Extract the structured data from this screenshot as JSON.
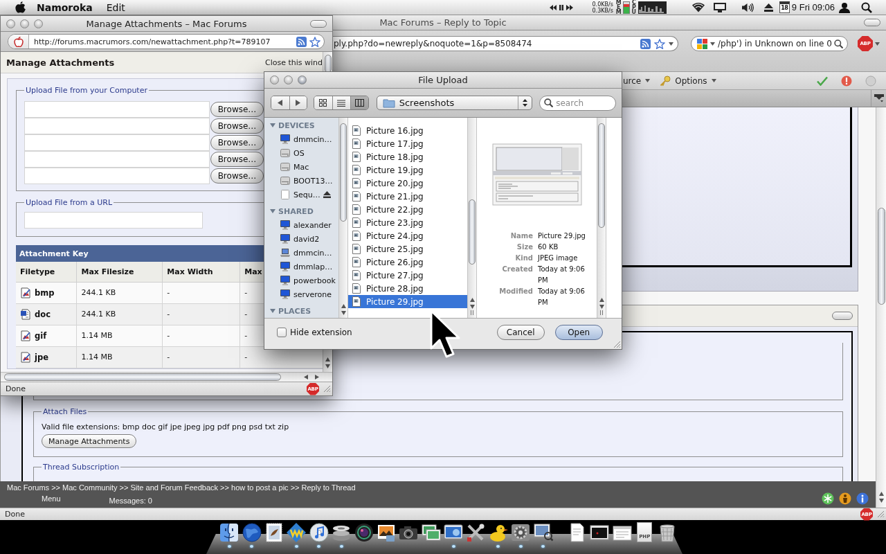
{
  "menu_bar": {
    "app_name": "Namoroka",
    "menus": [
      "Edit"
    ],
    "net_down": "0.0KB/s",
    "net_up": "0.3KB/s",
    "mem_label": "MEM",
    "cpu_label": "CPU",
    "calendar_day": "18",
    "clock": "9 Fri 09:06"
  },
  "browser": {
    "title": "Mac Forums – Reply to Topic",
    "url": "ply.php?do=newreply&noquote=1&p=8508474",
    "search_value": "/php') in Unknown on line 0",
    "addon_badge": "ABP",
    "toolbar_menus": [
      {
        "kind": "plain",
        "label": "urce"
      },
      {
        "kind": "key",
        "label": "Options"
      }
    ],
    "page": {
      "attach_files": {
        "legend": "Attach Files",
        "extensions": "Valid file extensions: bmp doc gif jpe jpeg jpg pdf png psd txt zip",
        "button": "Manage Attachments"
      },
      "thread_subscription": {
        "legend": "Thread Subscription"
      }
    },
    "footer": {
      "breadcrumb": "Mac Forums >> Mac Community >> Site and Forum Feedback >> how to post a pic >> Reply to Thread",
      "menu": "Menu",
      "messages": "Messages: 0"
    },
    "status": "Done",
    "status_badge": "ABP"
  },
  "attachments_window": {
    "title": "Manage Attachments – Mac Forums",
    "url": "http://forums.macrumors.com/newattachment.php?t=789107",
    "heading": "Manage Attachments",
    "close_link": "Close this wind",
    "upload_computer": {
      "legend": "Upload File from your Computer",
      "browse_buttons": [
        "Browse…",
        "Browse…",
        "Browse…",
        "Browse…",
        "Browse…"
      ]
    },
    "upload_url": {
      "legend": "Upload File from a URL"
    },
    "attachment_key": {
      "title": "Attachment Key",
      "columns": [
        "Filetype",
        "Max Filesize",
        "Max Width",
        "Max"
      ],
      "rows": [
        {
          "kind": "image",
          "filetype": "bmp",
          "max_filesize": "244.1 KB",
          "max_width": "-",
          "column_4": "-"
        },
        {
          "kind": "document",
          "filetype": "doc",
          "max_filesize": "244.1 KB",
          "max_width": "-",
          "column_4": "-"
        },
        {
          "kind": "image",
          "filetype": "gif",
          "max_filesize": "1.14 MB",
          "max_width": "-",
          "column_4": "-"
        },
        {
          "kind": "image",
          "filetype": "jpe",
          "max_filesize": "1.14 MB",
          "max_width": "-",
          "column_4": "-"
        }
      ]
    },
    "status": "Done",
    "status_badge": "ABP"
  },
  "file_dialog": {
    "title": "File Upload",
    "view_modes": [
      {
        "kind": "icon",
        "selected": false
      },
      {
        "kind": "list",
        "selected": false
      },
      {
        "kind": "column",
        "selected": true
      }
    ],
    "location": "Screenshots",
    "search_placeholder": "search",
    "sidebar": [
      {
        "heading": "DEVICES",
        "expanded": true,
        "items": [
          {
            "kind": "monitor",
            "label": "dmmcin…",
            "eject": false
          },
          {
            "kind": "disk",
            "label": "OS",
            "eject": false
          },
          {
            "kind": "disk",
            "label": "Mac",
            "eject": false
          },
          {
            "kind": "disk",
            "label": "BOOT13…",
            "eject": false
          },
          {
            "kind": "blank-disk",
            "label": "Sequ…",
            "eject": true
          }
        ]
      },
      {
        "heading": "SHARED",
        "expanded": true,
        "items": [
          {
            "kind": "monitor",
            "label": "alexander",
            "eject": false
          },
          {
            "kind": "monitor",
            "label": "david2",
            "eject": false
          },
          {
            "kind": "laptop",
            "label": "dmmcin…",
            "eject": false
          },
          {
            "kind": "monitor",
            "label": "dmmlap…",
            "eject": false
          },
          {
            "kind": "monitor",
            "label": "powerbook",
            "eject": false
          },
          {
            "kind": "monitor",
            "label": "serverone",
            "eject": false
          }
        ]
      },
      {
        "heading": "PLACES",
        "expanded": true
      }
    ],
    "files": [
      {
        "name": "Picture 16.jpg",
        "selected": false
      },
      {
        "name": "Picture 17.jpg",
        "selected": false
      },
      {
        "name": "Picture 18.jpg",
        "selected": false
      },
      {
        "name": "Picture 19.jpg",
        "selected": false
      },
      {
        "name": "Picture 20.jpg",
        "selected": false
      },
      {
        "name": "Picture 21.jpg",
        "selected": false
      },
      {
        "name": "Picture 22.jpg",
        "selected": false
      },
      {
        "name": "Picture 23.jpg",
        "selected": false
      },
      {
        "name": "Picture 24.jpg",
        "selected": false
      },
      {
        "name": "Picture 25.jpg",
        "selected": false
      },
      {
        "name": "Picture 26.jpg",
        "selected": false
      },
      {
        "name": "Picture 27.jpg",
        "selected": false
      },
      {
        "name": "Picture 28.jpg",
        "selected": false
      },
      {
        "name": "Picture 29.jpg",
        "selected": true
      }
    ],
    "preview": [
      {
        "label": "Name",
        "value": "Picture 29.jpg"
      },
      {
        "label": "Size",
        "value": "60 KB"
      },
      {
        "label": "Kind",
        "value": "JPEG image"
      },
      {
        "label": "Created",
        "value": "Today at 9:06 PM"
      },
      {
        "label": "Modified",
        "value": "Today at 9:06 PM"
      }
    ],
    "hide_extension": {
      "label": "Hide extension",
      "checked": false
    },
    "buttons": [
      {
        "label": "Cancel",
        "default": false
      },
      {
        "label": "Open",
        "default": true
      }
    ]
  },
  "dock": {
    "apps": [
      {
        "kind": "finder",
        "running": true
      },
      {
        "kind": "globe",
        "running": true
      },
      {
        "kind": "stamp",
        "running": false
      },
      {
        "kind": "squiggle",
        "running": true
      },
      {
        "kind": "music-disc",
        "running": true
      },
      {
        "kind": "disk-stack",
        "running": true
      },
      {
        "kind": "lens",
        "running": false
      },
      {
        "kind": "photo",
        "running": false
      },
      {
        "kind": "camera",
        "running": false
      },
      {
        "kind": "picture-stack",
        "running": false
      },
      {
        "kind": "screen-globe",
        "running": true
      },
      {
        "kind": "tools",
        "running": false
      },
      {
        "kind": "duck",
        "running": true
      },
      {
        "kind": "gear",
        "running": true
      },
      {
        "kind": "photo-magnifier",
        "running": true
      }
    ],
    "documents": [
      {
        "kind": "document"
      },
      {
        "kind": "dark-screen"
      },
      {
        "kind": "window"
      },
      {
        "kind": "php-document",
        "label": "PHP"
      },
      {
        "kind": "trash"
      }
    ]
  }
}
